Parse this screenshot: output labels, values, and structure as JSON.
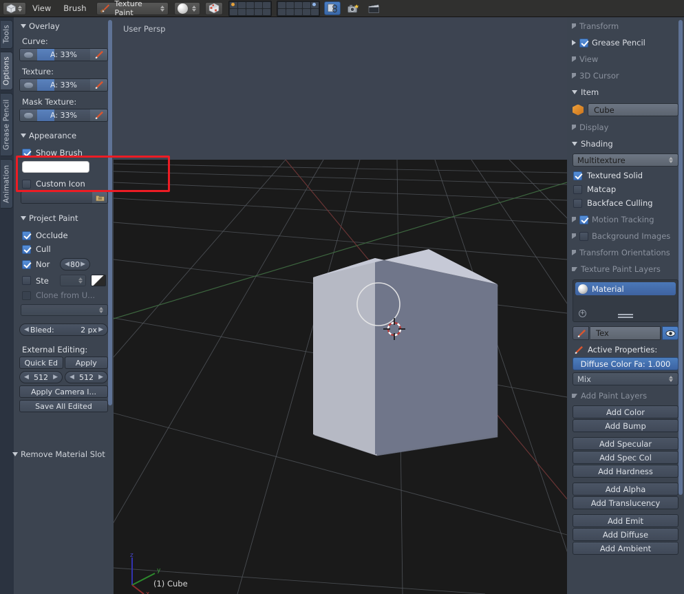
{
  "header": {
    "editor_type_icon": "editor-type-icon",
    "menus": [
      "View",
      "Brush"
    ],
    "mode": "Texture Paint",
    "mode_icon": "texture-paint-icon",
    "shading_icon": "shading-sphere-icon",
    "texture_shading_icon": "textured-cube-icon",
    "scene_layers_label": "scene-layers",
    "snap_icon": "snap-icon",
    "render_icon": "render-camera-icon",
    "animation_icon": "render-animation-icon"
  },
  "tabstrip": {
    "items": [
      "Tools",
      "Options",
      "Grease Pencil",
      "Animation"
    ],
    "selected": "Options"
  },
  "left_panel": {
    "overlay": {
      "title": "Overlay",
      "curve_label": "Curve:",
      "curve_value": "A: 33%",
      "texture_label": "Texture:",
      "texture_value": "A: 33%",
      "mask_label": "Mask Texture:",
      "mask_value": "A: 33%"
    },
    "appearance": {
      "title": "Appearance",
      "show_brush_label": "Show Brush",
      "show_brush_checked": true,
      "brush_color": "#ffffff",
      "custom_icon_label": "Custom Icon",
      "custom_icon_checked": false,
      "icon_path_value": ""
    },
    "project_paint": {
      "title": "Project Paint",
      "occlude_label": "Occlude",
      "occlude_checked": true,
      "cull_label": "Cull",
      "cull_checked": true,
      "normal_label": "Nor",
      "normal_checked": true,
      "normal_value": "80",
      "stencil_label": "Ste",
      "stencil_checked": false,
      "clone_label": "Clone from U...",
      "clone_checked": false,
      "clone_layer_value": "",
      "bleed_label": "Bleed:",
      "bleed_value": "2 px"
    },
    "external_editing": {
      "title": "External Editing:",
      "quick_edit": "Quick Ed",
      "apply": "Apply",
      "width": "512",
      "height": "512",
      "apply_camera": "Apply Camera I...",
      "save_all": "Save All Edited"
    },
    "bottom_header": "Remove Material Slot"
  },
  "viewport": {
    "perspective": "User Persp",
    "object_name": "(1) Cube",
    "axis": {
      "x": "x",
      "y": "y",
      "z": "z"
    },
    "colors": {
      "sky": "#3d4451",
      "floor": "#1b1b1b",
      "cube_top": "#c4c7d4",
      "cube_right": "#6d7385",
      "cube_left": "#b4b7c2",
      "grid": "#555a60",
      "axis_x": "#7a3a3a",
      "axis_y": "#3a6b3a"
    }
  },
  "right_panel": {
    "sections": [
      {
        "name": "Transform",
        "open": false,
        "checkbox": null
      },
      {
        "name": "Grease Pencil",
        "open": false,
        "checkbox": true
      },
      {
        "name": "View",
        "open": false,
        "checkbox": null
      },
      {
        "name": "3D Cursor",
        "open": false,
        "checkbox": null
      },
      {
        "name": "Item",
        "open": true,
        "checkbox": null
      }
    ],
    "item": {
      "object_name": "Cube"
    },
    "display": {
      "title": "Display",
      "open": false
    },
    "shading": {
      "title": "Shading",
      "open": true,
      "method": "Multitexture",
      "textured_solid_label": "Textured Solid",
      "textured_solid_checked": true,
      "matcap_label": "Matcap",
      "matcap_checked": false,
      "backface_label": "Backface Culling",
      "backface_checked": false
    },
    "motion_tracking": {
      "title": "Motion Tracking",
      "checked": true
    },
    "background_images": {
      "title": "Background Images",
      "checked": false
    },
    "transform_orientations": {
      "title": "Transform Orientations"
    },
    "texture_paint_layers": {
      "title": "Texture Paint Layers",
      "material_name": "Material",
      "texture_name": "Tex",
      "active_properties_label": "Active Properties:",
      "diffuse_label": "Diffuse Color Fa: 1.000",
      "blend_mode": "Mix"
    },
    "add_paint_layers": {
      "title": "Add Paint Layers",
      "groups": [
        [
          "Add Color",
          "Add Bump"
        ],
        [
          "Add Specular",
          "Add Spec Col",
          "Add Hardness"
        ],
        [
          "Add Alpha",
          "Add Translucency"
        ],
        [
          "Add Emit",
          "Add Diffuse",
          "Add Ambient"
        ]
      ]
    }
  },
  "annotation": {
    "highlight_color": "#ed1c24",
    "target": "show-brush-and-color"
  }
}
